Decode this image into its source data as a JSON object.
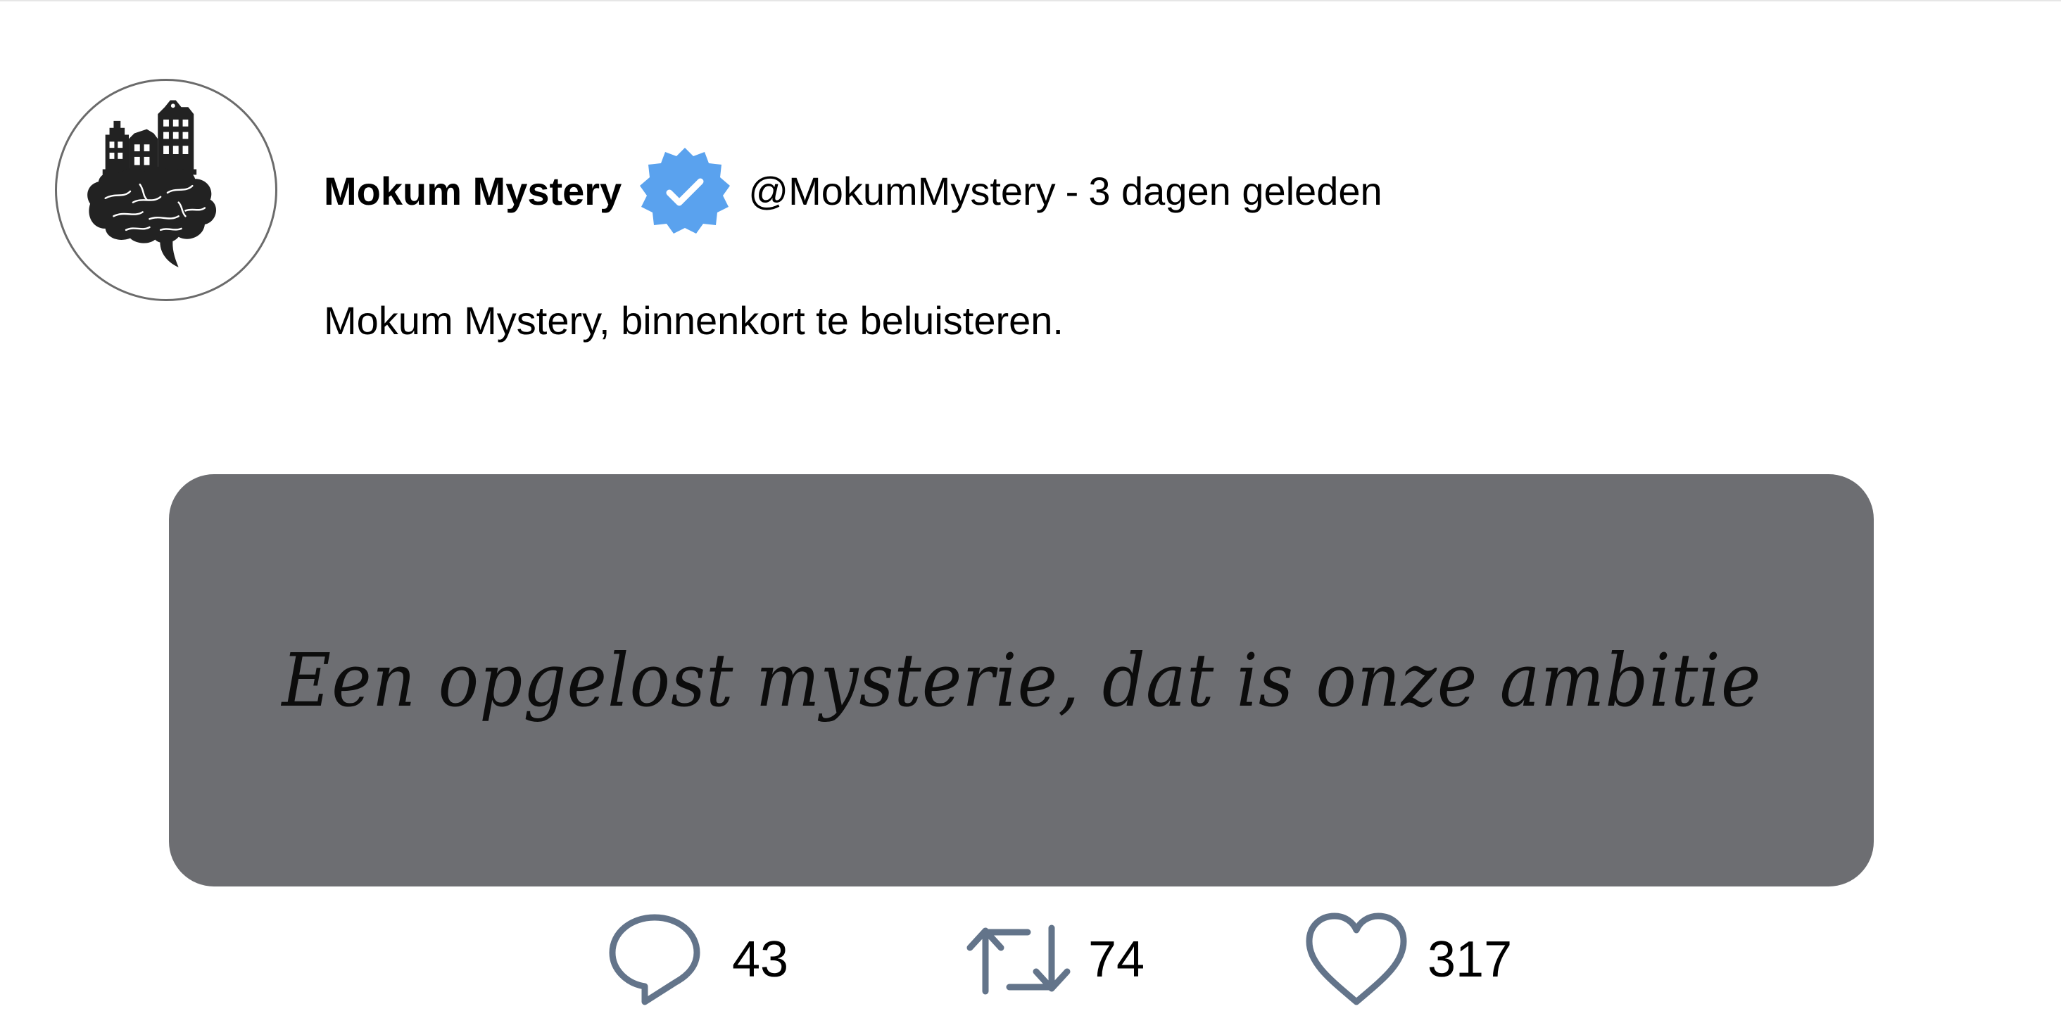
{
  "tweet": {
    "display_name": "Mokum Mystery",
    "handle": "@MokumMystery",
    "separator": "-",
    "timestamp": "3 dagen geleden",
    "text": "Mokum Mystery, binnenkort te beluisteren.",
    "media_quote": "Een opgelost mysterie, dat is onze ambitie",
    "verified_badge_color": "#5aa2ee",
    "media_background_color": "#6d6e72"
  },
  "actions": {
    "reply_count": "43",
    "retweet_count": "74",
    "like_count": "317",
    "icon_color": "#63748a"
  },
  "icons": {
    "avatar": "brain-with-canal-houses-logo",
    "verified": "verified-badge-icon",
    "reply": "reply-bubble-icon",
    "retweet": "retweet-arrows-icon",
    "like": "heart-outline-icon"
  }
}
